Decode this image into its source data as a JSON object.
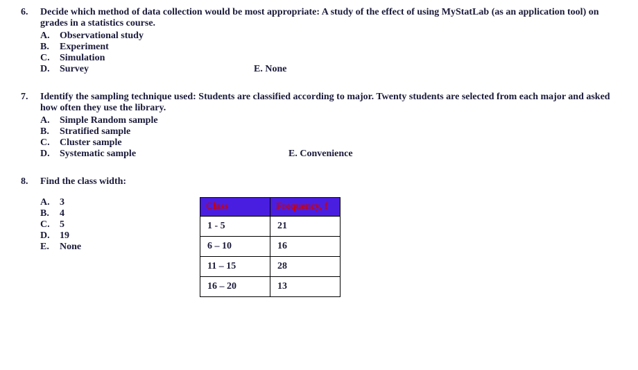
{
  "q6": {
    "num": "6.",
    "text": "Decide which method of data collection would be most appropriate:  A study of the effect of using MyStatLab (as an application tool) on grades in a statistics course.",
    "A": "Observational study",
    "B": "Experiment",
    "C": "Simulation",
    "D": "Survey",
    "E": "E. None"
  },
  "q7": {
    "num": "7.",
    "text": "Identify the sampling technique used: Students are classified according to major. Twenty students are selected from each major and asked how often they use the library.",
    "A": "Simple Random sample",
    "B": "Stratified sample",
    "C": "Cluster sample",
    "D": "Systematic sample",
    "E": "E. Convenience"
  },
  "q8": {
    "num": "8.",
    "text": "Find the class width:",
    "A": "3",
    "B": "4",
    "C": "5",
    "D": "19",
    "E": "None",
    "table": {
      "h1": "Class",
      "h2": "Frequency, f",
      "rows": [
        {
          "c1": "1 -  5",
          "c2": "21"
        },
        {
          "c1": "6 – 10",
          "c2": "16"
        },
        {
          "c1": "11 – 15",
          "c2": "28"
        },
        {
          "c1": "16 – 20",
          "c2": "13"
        }
      ]
    }
  },
  "chart_data": {
    "type": "table",
    "title": "Frequency Distribution",
    "columns": [
      "Class",
      "Frequency, f"
    ],
    "rows": [
      [
        "1 - 5",
        21
      ],
      [
        "6 - 10",
        16
      ],
      [
        "11 - 15",
        28
      ],
      [
        "16 - 20",
        13
      ]
    ]
  },
  "labels": {
    "A": "A.",
    "B": "B.",
    "C": "C.",
    "D": "D.",
    "E": "E."
  }
}
